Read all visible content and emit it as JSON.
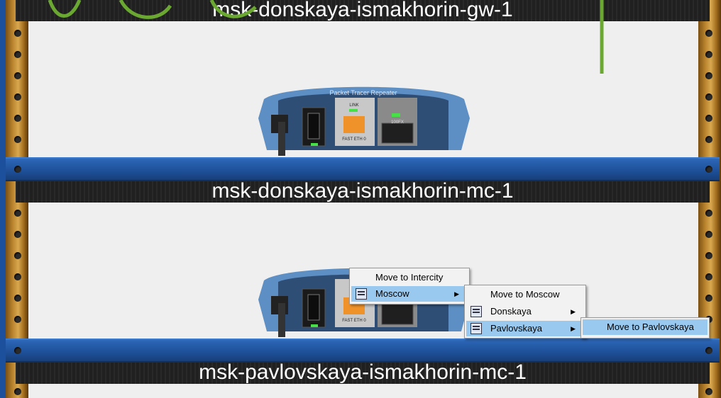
{
  "racks": [
    {
      "label": "msk-donskaya-ismakhorin-gw-1"
    },
    {
      "label": "msk-donskaya-ismakhorin-mc-1"
    },
    {
      "label": "msk-pavlovskaya-ismakhorin-mc-1"
    }
  ],
  "device": {
    "title": "Packet Tracer Repeater",
    "link_label": "LINK",
    "port_label": "FAST ETH 0",
    "fx_label": "100FX"
  },
  "context_menu": {
    "items": [
      {
        "label": "Move to Intercity"
      },
      {
        "label": "Moscow",
        "icon": "building-icon",
        "submenu": true
      }
    ]
  },
  "submenu_moscow": {
    "items": [
      {
        "label": "Move to Moscow"
      },
      {
        "label": "Donskaya",
        "icon": "building-icon",
        "submenu": true
      },
      {
        "label": "Pavlovskaya",
        "icon": "building-icon",
        "submenu": true
      }
    ]
  },
  "submenu_pavlovskaya": {
    "items": [
      {
        "label": "Move to Pavlovskaya"
      }
    ]
  },
  "colors": {
    "rail": "#1d4f97",
    "rack_post": "#b8832c",
    "menu_highlight": "#99c9ef",
    "cable": "#6aa832"
  }
}
